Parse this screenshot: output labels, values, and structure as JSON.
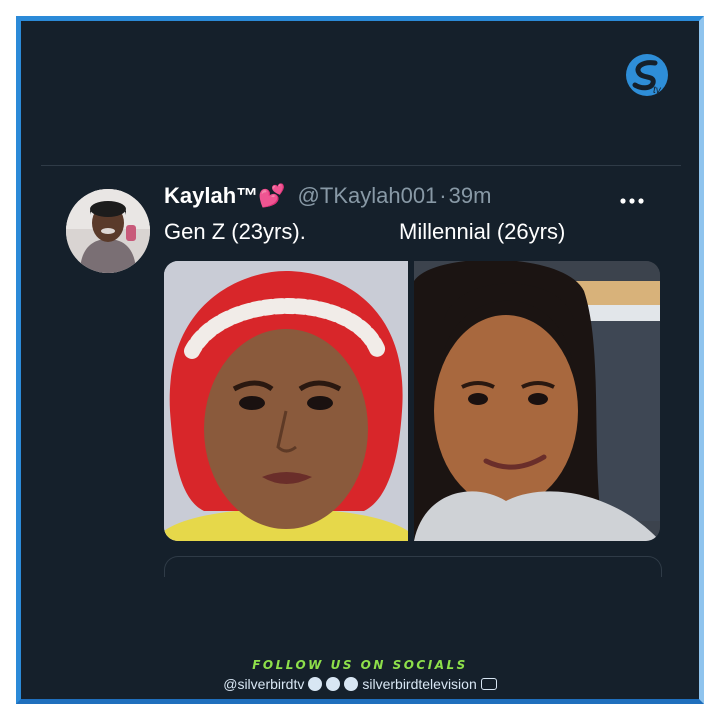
{
  "tweet": {
    "display_name": "Kaylah™💕",
    "handle": "@TKaylah001",
    "separator": "·",
    "time": "39m",
    "text_left": "Gen Z (23yrs).",
    "text_right": "Millennial (26yrs)"
  },
  "overlay": {
    "follow_text": "FOLLOW US ON SOCIALS",
    "handle_left": "@silverbirdtv",
    "handle_right": "silverbirdtelevision",
    "logo_text": "tv"
  },
  "icons": {
    "more": "more-horizontal-icon",
    "instagram": "instagram-icon",
    "twitter": "twitter-icon",
    "facebook": "facebook-icon",
    "youtube": "youtube-icon",
    "brand": "silverbird-logo-icon"
  },
  "colors": {
    "background": "#15202b",
    "frame": "#2b8ad8",
    "follow": "#8ee04a",
    "secondary_text": "#8899a6"
  }
}
